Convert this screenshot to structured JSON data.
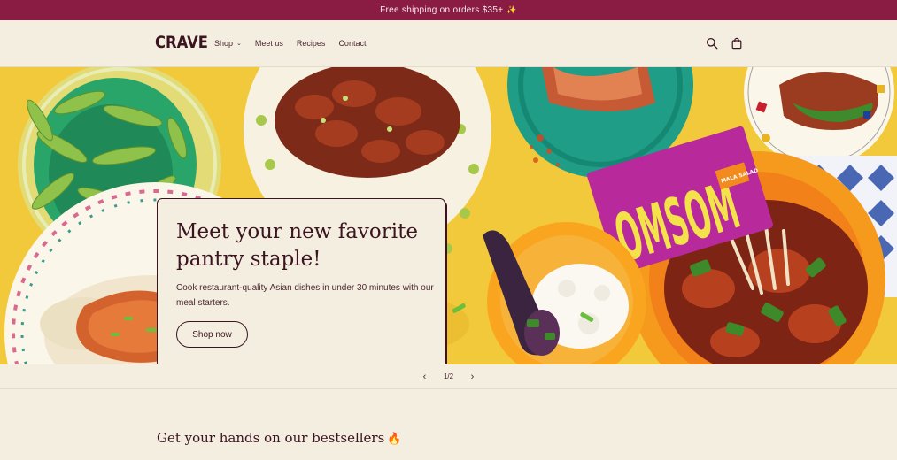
{
  "announcement": {
    "text": "Free shipping on orders $35+",
    "emoji": "✨"
  },
  "header": {
    "logo": "CRAVE",
    "nav": [
      {
        "label": "Shop",
        "has_dropdown": true
      },
      {
        "label": "Meet us"
      },
      {
        "label": "Recipes"
      },
      {
        "label": "Contact"
      }
    ],
    "icons": [
      "search-icon",
      "cart-icon"
    ]
  },
  "hero": {
    "title": "Meet your new favorite pantry staple!",
    "subtitle": "Cook restaurant-quality Asian dishes in under 30 minutes with our meal starters.",
    "cta": "Shop now",
    "package_text": "OMSOM",
    "package_badge": "MALA SALAD"
  },
  "slider": {
    "prev": "‹",
    "counter": "1/2",
    "next": "›"
  },
  "bestsellers": {
    "title": "Get your hands on our bestsellers",
    "emoji": "🔥"
  },
  "colors": {
    "announcement_bg": "#8a1b43",
    "page_bg": "#f3eee0",
    "hero_bg": "#f2c93a",
    "text": "#3b1420",
    "package": "#b8299c"
  }
}
